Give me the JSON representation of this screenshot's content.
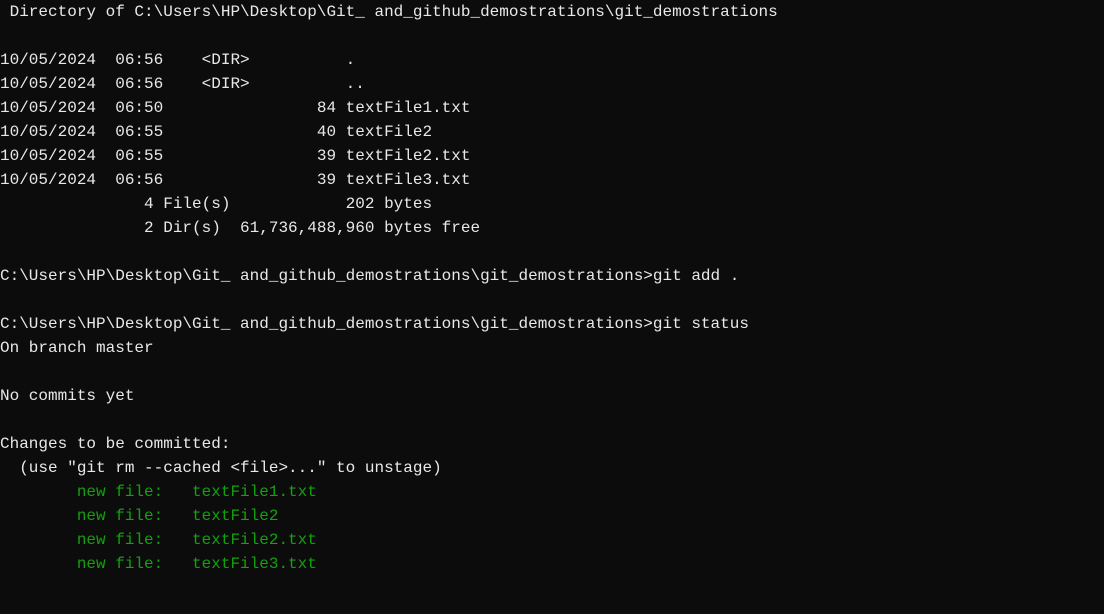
{
  "header": " Directory of C:\\Users\\HP\\Desktop\\Git_ and_github_demostrations\\git_demostrations",
  "listing": [
    "10/05/2024  06:56    <DIR>          .",
    "10/05/2024  06:56    <DIR>          ..",
    "10/05/2024  06:50                84 textFile1.txt",
    "10/05/2024  06:55                40 textFile2",
    "10/05/2024  06:55                39 textFile2.txt",
    "10/05/2024  06:56                39 textFile3.txt",
    "               4 File(s)            202 bytes",
    "               2 Dir(s)  61,736,488,960 bytes free"
  ],
  "prompt_path": "C:\\Users\\HP\\Desktop\\Git_ and_github_demostrations\\git_demostrations>",
  "cmd1": "git add .",
  "cmd2": "git status",
  "branch_line": "On branch master",
  "no_commits": "No commits yet",
  "changes_header": "Changes to be committed:",
  "unstage_hint": "  (use \"git rm --cached <file>...\" to unstage)",
  "new_files": [
    "        new file:   textFile1.txt",
    "        new file:   textFile2",
    "        new file:   textFile2.txt",
    "        new file:   textFile3.txt"
  ]
}
